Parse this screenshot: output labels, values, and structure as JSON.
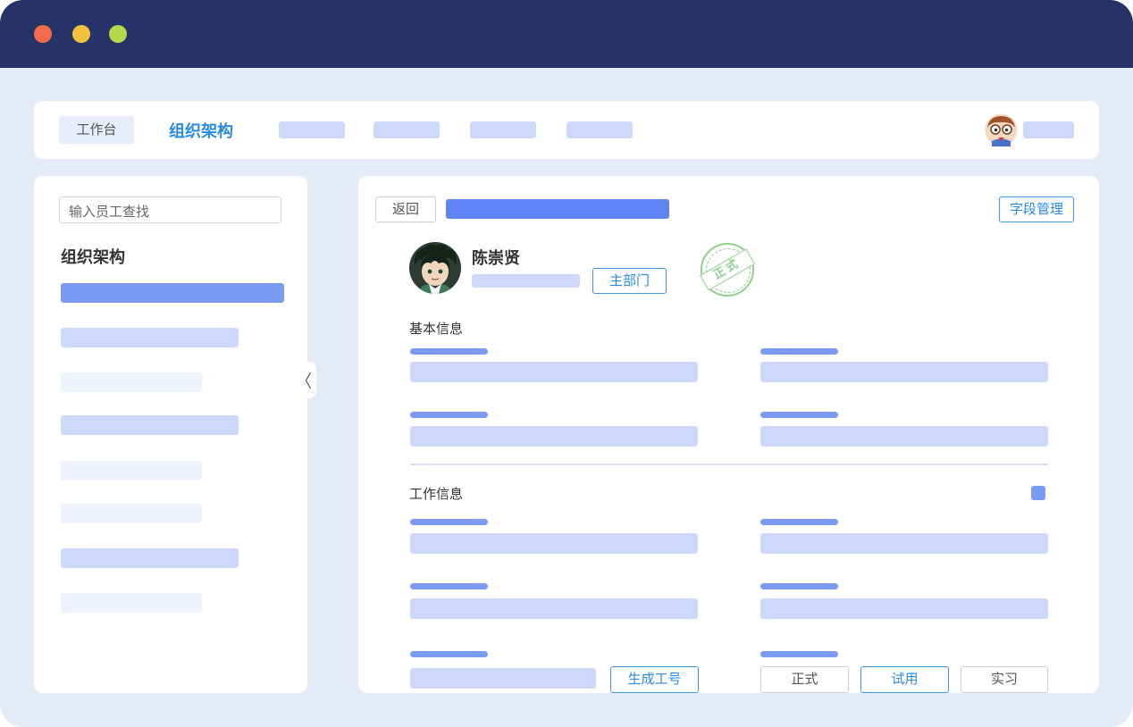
{
  "topnav": {
    "workbench_label": "工作台",
    "active_label": "组织架构"
  },
  "sidebar": {
    "search_placeholder": "输入员工查找",
    "title": "组织架构"
  },
  "detail": {
    "back_label": "返回",
    "field_manage_label": "字段管理",
    "employee_name": "陈崇贤",
    "main_dept_label": "主部门",
    "stamp_text": "正式",
    "section_basic": "基本信息",
    "section_work": "工作信息",
    "generate_id_label": "生成工号",
    "status_options": [
      "正式",
      "试用",
      "实习"
    ],
    "selected_status": "试用"
  },
  "colors": {
    "titlebar": "#263369",
    "background": "#e4eaf6",
    "accent": "#3f95e0",
    "placeholder": "#ccd9fa",
    "highlight": "#7b9af2",
    "stamp": "#8fd18a"
  }
}
